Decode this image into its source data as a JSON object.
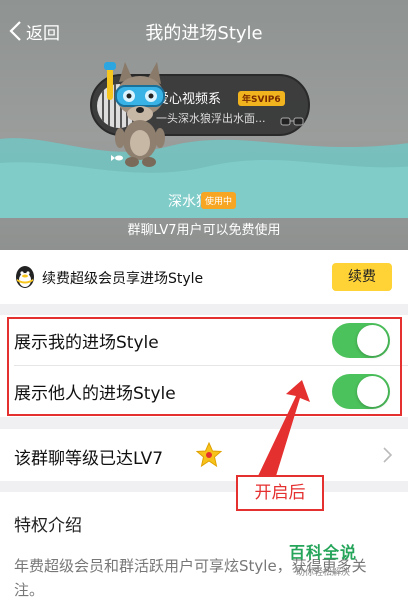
{
  "nav": {
    "back_label": "返回",
    "title": "我的进场Style"
  },
  "preview": {
    "pill_name": "爱心视频系",
    "svip_badge": "年SVIP6",
    "pill_message": "一头深水狼浮出水面...",
    "style_name": "深水狼",
    "in_use_badge": "使用中",
    "hint": "群聊LV7用户可以免费使用"
  },
  "vip": {
    "text": "续费超级会员享进场Style",
    "renew_label": "续费"
  },
  "toggles": [
    {
      "label": "展示我的进场Style",
      "on": true
    },
    {
      "label": "展示他人的进场Style",
      "on": true
    }
  ],
  "level": {
    "text": "该群聊等级已达LV7"
  },
  "annotation": {
    "label": "开启后"
  },
  "privilege": {
    "title": "特权介绍",
    "desc": "年费超级会员和群活跃用户可享炫Style，获得更多关注。"
  },
  "watermark": {
    "main": "百科全说",
    "sub": "助你轻松解决"
  },
  "colors": {
    "switch_on": "#4cc25c",
    "annotation_red": "#e53030",
    "renew_yellow": "#ffd235",
    "in_use_orange": "#f6a623"
  }
}
